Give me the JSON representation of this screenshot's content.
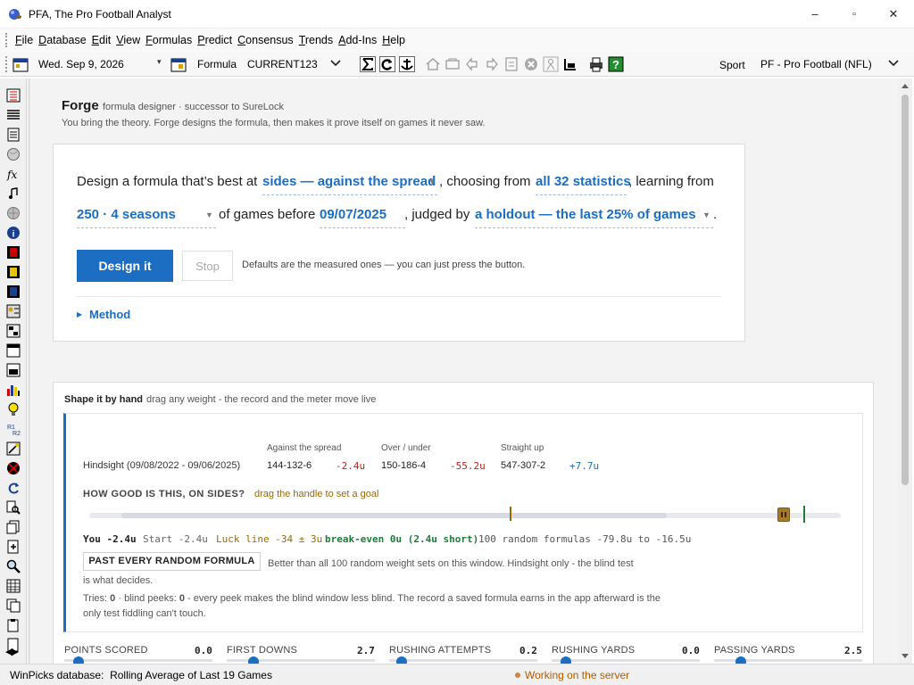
{
  "window": {
    "title": "PFA, The Pro Football Analyst",
    "min": "–",
    "max": "▫",
    "close": "✕"
  },
  "menu": [
    "File",
    "Database",
    "Edit",
    "View",
    "Formulas",
    "Predict",
    "Consensus",
    "Trends",
    "Add-Ins",
    "Help"
  ],
  "toolbar": {
    "date": "Wed. Sep  9, 2026",
    "formula_label": "Formula",
    "formula_value": "CURRENT123",
    "sport_label": "Sport",
    "sport_value": "PF - Pro Football (NFL)"
  },
  "forge": {
    "title": "Forge",
    "subtitle": "formula designer · successor to SureLock",
    "tagline": "You bring the theory. Forge designs the formula, then makes it prove itself on games it never saw.",
    "s1": "Design a formula that’s best at",
    "c1": "sides — against the spread",
    "s2": ", choosing from",
    "c2": "all 32 statistics",
    "s3": ", learning from",
    "c3": "250 · 4 seasons",
    "s4": "of games before",
    "c4": "09/07/2025",
    "s5": ", judged by",
    "c5": "a holdout — the last 25% of games",
    "s6": ".",
    "design_btn": "Design it",
    "stop_btn": "Stop",
    "defaults_note": "Defaults are the measured ones — you can just press the button.",
    "method": "Method"
  },
  "shape": {
    "title": "Shape it by hand",
    "hint": "drag any weight - the record and the meter move live",
    "col_ats": "Against the spread",
    "col_ou": "Over / under",
    "col_su": "Straight up",
    "row_label": "Hindsight (09/08/2022 - 09/06/2025)",
    "ats_rec": "144-132-6",
    "ats_units": "-2.4u",
    "ou_rec": "150-186-4",
    "ou_units": "-55.2u",
    "su_rec": "547-307-2",
    "su_units": "+7.7u",
    "how_good": "HOW GOOD IS THIS, ON SIDES?",
    "how_hint": "drag the handle to set a goal",
    "you": "You -2.4u",
    "start": "Start -2.4u",
    "luck": "Luck line -34 ± 3u",
    "breakeven": "break-even 0u (2.4u short)",
    "random": "100 random formulas -79.8u to -16.5u",
    "verdict": "PAST EVERY RANDOM FORMULA",
    "verdict_text": "Better than all 100 random weight sets on this window. Hindsight only - the blind test is what decides.",
    "tries_label": "Tries:",
    "tries_value": "0",
    "peeks_label": "· blind peeks:",
    "peeks_value": "0",
    "tries_text": "- every peek makes the blind window less blind. The record a saved formula earns in the app afterward is the only test fiddling can't touch."
  },
  "weights": [
    {
      "name": "POINTS SCORED",
      "value": "0.0"
    },
    {
      "name": "FIRST DOWNS",
      "value": "2.7"
    },
    {
      "name": "RUSHING ATTEMPTS",
      "value": "0.2"
    },
    {
      "name": "RUSHING YARDS",
      "value": "0.0"
    },
    {
      "name": "PASSING YARDS",
      "value": "2.5"
    }
  ],
  "status": {
    "db_label": "WinPicks database:",
    "db_value": "Rolling Average of Last 19 Games",
    "server": "Working on the server"
  },
  "colors": {
    "accent": "#1b6ec2",
    "negative": "#b3261e",
    "luck": "#9a6a00",
    "goal": "#1f7a3a"
  }
}
